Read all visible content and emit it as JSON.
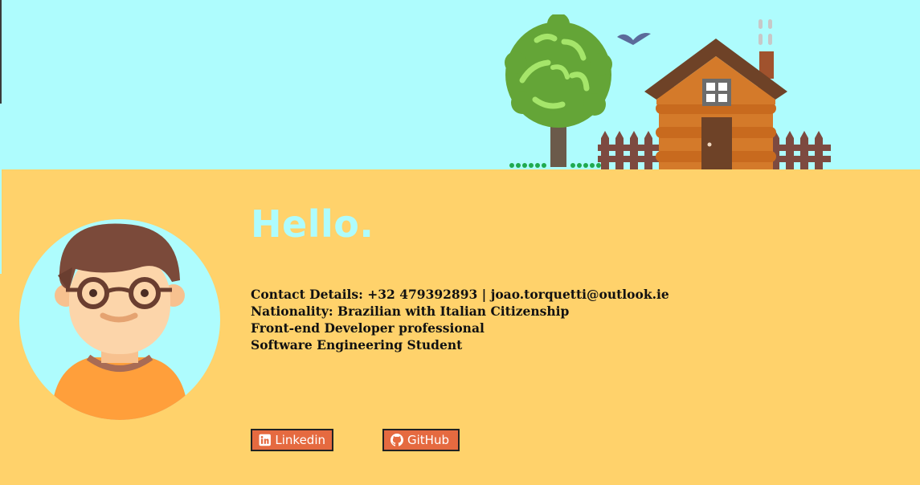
{
  "hero": {
    "greeting": "Hello."
  },
  "profile": {
    "contact": "Contact Details: +32 479392893 | joao.torquetti@outlook.ie",
    "nationality": "Nationality: Brazilian with Italian Citizenship",
    "role": "Front-end Developer professional",
    "study": "Software Engineering Student"
  },
  "links": {
    "linkedin_label": "Linkedin",
    "github_label": "GitHub"
  },
  "icons": {
    "linkedin": "linkedin-icon",
    "github": "github-icon"
  },
  "colors": {
    "sky": "#aefcfd",
    "ground": "#ffd26b",
    "button": "#e56a40"
  }
}
